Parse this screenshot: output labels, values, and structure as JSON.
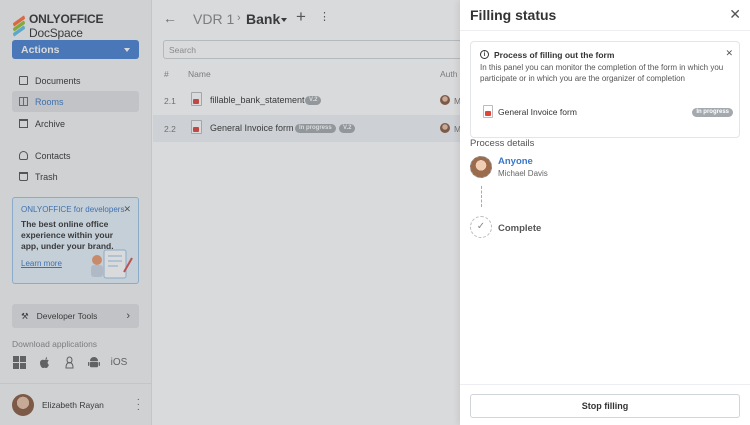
{
  "brand": {
    "bold": "ONLYOFFICE",
    "rest": " DocSpace"
  },
  "sidebar": {
    "actions_label": "Actions",
    "items": [
      {
        "label": "Documents",
        "icon": "documents-icon"
      },
      {
        "label": "Rooms",
        "icon": "rooms-icon",
        "active": true
      },
      {
        "label": "Archive",
        "icon": "archive-icon"
      },
      {
        "label": "Contacts",
        "icon": "contacts-icon"
      },
      {
        "label": "Trash",
        "icon": "trash-icon"
      }
    ],
    "promo": {
      "title": "ONLYOFFICE for developers",
      "body": "The best online office experience within your app, under your brand.",
      "link": "Learn more"
    },
    "developer_tools": "Developer Tools",
    "download_label": "Download applications",
    "ios_label": "iOS",
    "user_name": "Elizabeth Rayan"
  },
  "main": {
    "breadcrumb": {
      "parent": "VDR 1",
      "current": "Bank"
    },
    "search_placeholder": "Search",
    "columns": {
      "num": "#",
      "name": "Name",
      "author": "Auth"
    },
    "rows": [
      {
        "num": "2.1",
        "name": "fillable_bank_statement",
        "badges": [
          "V.2"
        ],
        "author": "M"
      },
      {
        "num": "2.2",
        "name": "General Invoice form",
        "badges": [
          "In progress",
          "V.2"
        ],
        "author": "M",
        "selected": true
      }
    ]
  },
  "panel": {
    "title": "Filling status",
    "info": {
      "title": "Process of filling out the form",
      "description": "In this panel you can monitor the completion of the form in which you participate or in which you are the organizer of completion",
      "form_name": "General Invoice form",
      "form_badge": "In progress"
    },
    "process_title": "Process details",
    "steps": [
      {
        "role": "Anyone",
        "user": "Michael Davis"
      },
      {
        "role": "Complete"
      }
    ],
    "stop_button": "Stop filling"
  },
  "colors": {
    "accent": "#4781d1",
    "link": "#3a78c5",
    "badge": "#a3a9ae",
    "pdf": "#e0443b"
  }
}
